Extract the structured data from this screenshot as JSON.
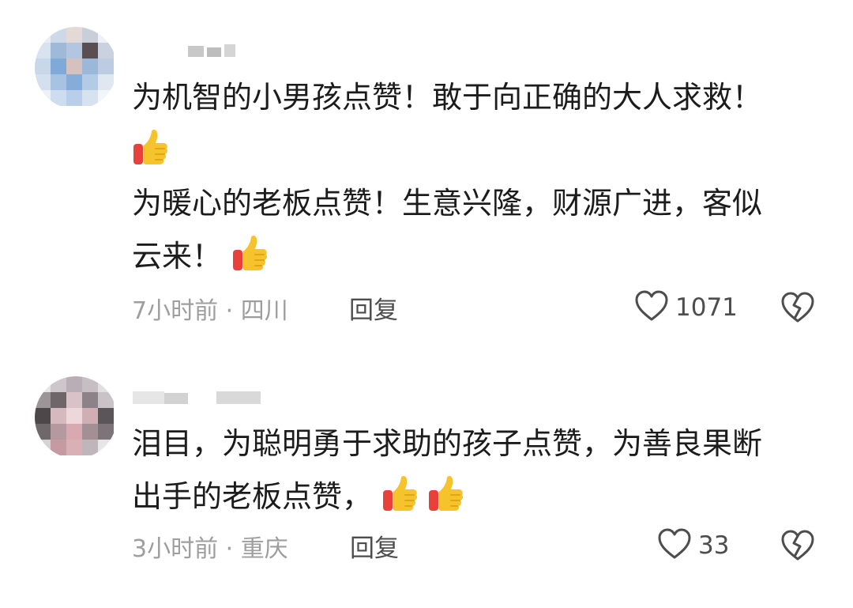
{
  "comments": [
    {
      "lines": [
        {
          "text": "为机智的小男孩点赞！敢于向正确的大人求救！",
          "thumbs": 0
        },
        {
          "text": "",
          "thumbs": 1
        },
        {
          "text": "为暖心的老板点赞！生意兴隆，财源广进，客似",
          "thumbs": 0
        },
        {
          "text": "云来！",
          "thumbs": 1
        }
      ],
      "time_location": "7小时前 · 四川",
      "reply_label": "回复",
      "like_count": "1071"
    },
    {
      "lines": [
        {
          "text": "泪目，为聪明勇于求助的孩子点赞，为善良果断",
          "thumbs": 0
        },
        {
          "text": "出手的老板点赞，",
          "thumbs": 2
        }
      ],
      "time_location": "3小时前 · 重庆",
      "reply_label": "回复",
      "like_count": "33"
    }
  ],
  "icons": {
    "like": "heart-outline-icon",
    "dislike": "broken-heart-icon",
    "emoji": "thumbs-up-emoji"
  },
  "colors": {
    "text": "#1c1c1c",
    "meta": "#9e9e9e",
    "action": "#4d4d4d",
    "thumb_yellow": "#f5c42c",
    "thumb_red": "#e8413c"
  }
}
